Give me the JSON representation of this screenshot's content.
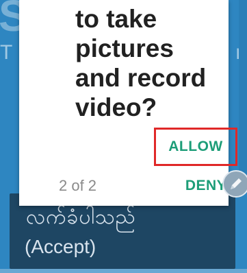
{
  "background": {
    "title_fragment": "S",
    "left_fragment": "T",
    "right_fragment": "n",
    "accept_native": "လက်ခံပါသည်",
    "accept_label": "(Accept)"
  },
  "dialog": {
    "message_lines": [
      "to take",
      "pictures",
      "and record",
      "video?"
    ],
    "allow_label": "ALLOW",
    "page_count": "2 of 2",
    "deny_label": "DENY"
  },
  "colors": {
    "app_background": "#2e86c1",
    "accent": "#1d9d78",
    "highlight": "#e02828",
    "panel": "#1e4663"
  },
  "icons": {
    "edit_fab": "pencil-icon"
  }
}
